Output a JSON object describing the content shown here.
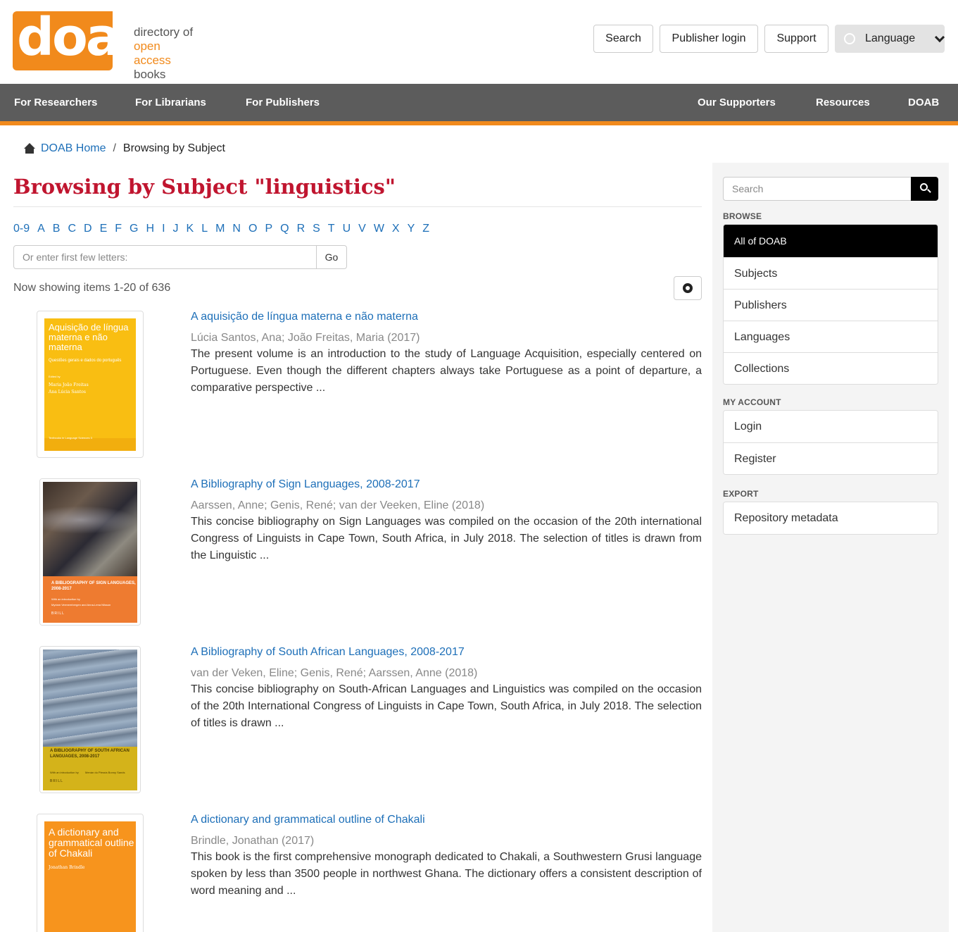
{
  "logo": {
    "word": "doab",
    "line1": "directory of",
    "line2": "open access",
    "line3": "books"
  },
  "header": {
    "search_label": "Search",
    "publisher_login_label": "Publisher login",
    "support_label": "Support",
    "language_label": "Language"
  },
  "nav": {
    "left": [
      "For Researchers",
      "For Librarians",
      "For Publishers"
    ],
    "right": [
      "Our Supporters",
      "Resources",
      "DOAB"
    ]
  },
  "breadcrumb": {
    "home": "DOAB Home",
    "separator": "/",
    "current": "Browsing by Subject"
  },
  "main": {
    "title": "Browsing by Subject \"linguistics\"",
    "letters": [
      "0-9",
      "A",
      "B",
      "C",
      "D",
      "E",
      "F",
      "G",
      "H",
      "I",
      "J",
      "K",
      "L",
      "M",
      "N",
      "O",
      "P",
      "Q",
      "R",
      "S",
      "T",
      "U",
      "V",
      "W",
      "X",
      "Y",
      "Z"
    ],
    "prefix_placeholder": "Or enter first few letters:",
    "go_label": "Go",
    "showing": "Now showing items 1-20 of 636"
  },
  "items": [
    {
      "title": "A aquisição de língua materna e não materna",
      "authors": "Lúcia Santos, Ana; João Freitas, Maria (2017)",
      "abstract": "The present volume is an introduction to the study of Language Acquisition, especially centered on Portuguese. Even though the different chapters always take Portuguese as a point of departure, a comparative perspective ...",
      "cover": {
        "title": "Aquisição de língua materna e não materna",
        "subtitle": "Questões gerais e dados do português",
        "edited_by": "Edited by",
        "names": "Maria João Freitas\nAna Lúcia Santos",
        "series": "Textbooks in Language Sciences 3",
        "bg": "#f9be12"
      }
    },
    {
      "title": "A Bibliography of Sign Languages, 2008-2017",
      "authors": "Aarssen, Anne; Genis, René; van der Veeken, Eline (2018)",
      "abstract": "This concise bibliography on Sign Languages was compiled on the occasion of the 20th international Congress of Linguists in Cape Town, South Africa, in July 2018. The selection of titles is drawn from the Linguistic ...",
      "cover": {
        "title": "A BIBLIOGRAPHY OF SIGN LANGUAGES, 2008-2017",
        "subtitle": "With an introduction by",
        "names": "Myriam Vermeerbergen and Anna-Lena Nilsson",
        "publisher": "BRILL",
        "bg": "#ee7b30"
      }
    },
    {
      "title": "A Bibliography of South African Languages, 2008-2017",
      "authors": "van der Veken, Eline; Genis, René; Aarssen, Anne (2018)",
      "abstract": "This concise bibliography on South-African Languages and Linguistics was compiled on the occasion of the 20th International Congress of Linguists in Cape Town, South Africa, in July 2018. The selection of titles is drawn ...",
      "cover": {
        "title": "A BIBLIOGRAPHY OF SOUTH AFRICAN LANGUAGES, 2008-2017",
        "subtitle": "With an introduction by",
        "names": "Menán du Plessis  Bonny Sands",
        "publisher": "BRILL",
        "bg": "#d4b31a"
      }
    },
    {
      "title": "A dictionary and grammatical outline of Chakali",
      "authors": "Brindle, Jonathan (2017)",
      "abstract": "This book is the first comprehensive monograph dedicated to Chakali, a Southwestern Grusi language spoken by less than 3500 people in northwest Ghana. The dictionary offers a consistent description of word meaning and ...",
      "cover": {
        "title": "A dictionary and grammatical outline of Chakali",
        "names": "Jonathan Brindle",
        "bg": "#f7941d"
      }
    }
  ],
  "sidebar": {
    "search_placeholder": "Search",
    "browse_heading": "Browse",
    "browse_items": [
      "All of DOAB",
      "Subjects",
      "Publishers",
      "Languages",
      "Collections"
    ],
    "account_heading": "My Account",
    "account_items": [
      "Login",
      "Register"
    ],
    "export_heading": "Export",
    "export_items": [
      "Repository metadata"
    ]
  },
  "colors": {
    "accent": "#f18a1c",
    "title_red": "#c0152f",
    "link": "#1d6fb8",
    "nav_bg": "#5c5c5c"
  }
}
